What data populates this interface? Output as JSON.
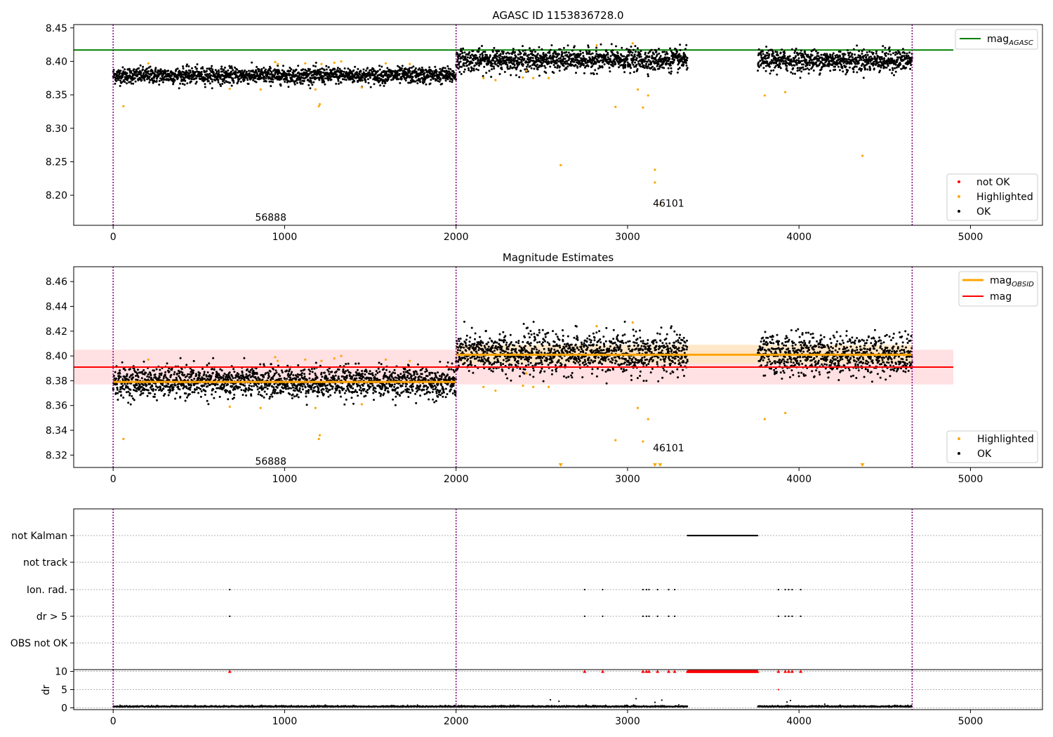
{
  "colors": {
    "ok": "#000000",
    "highlighted": "#ffa500",
    "not_ok": "#ff0000",
    "agasc_line": "#008000",
    "obsid_line": "#ffa500",
    "mag_line": "#ff0000",
    "obs_boundary": "#800080",
    "mag_band": "#ffdde0",
    "obsid_band": "#ffe6c2"
  },
  "chart_data": [
    {
      "type": "scatter",
      "title": "AGASC ID 1153836728.0",
      "xlim": [
        -230,
        5420
      ],
      "ylim": [
        8.155,
        8.455
      ],
      "xticks": [
        0,
        1000,
        2000,
        3000,
        4000,
        5000
      ],
      "yticks": [
        8.2,
        8.25,
        8.3,
        8.35,
        8.4,
        8.45
      ],
      "obsid_boundaries": [
        0,
        2000,
        4660
      ],
      "obsid_annotations": [
        {
          "x": 910,
          "y": 8.167,
          "label": "56888"
        },
        {
          "x": 3230,
          "y": 8.188,
          "label": "46101"
        }
      ],
      "reference_lines": [
        {
          "name": "mag",
          "subscript": "AGASC",
          "y": 8.417,
          "x_range": [
            -230,
            4900
          ],
          "color": "#008000"
        }
      ],
      "series": [
        {
          "name": "not OK",
          "color": "#ff0000"
        },
        {
          "name": "Highlighted",
          "color": "#ffa500"
        },
        {
          "name": "OK",
          "color": "#000000"
        }
      ],
      "ok_segments": [
        {
          "x_range": [
            0,
            2000
          ],
          "mean": 8.379,
          "spread": 0.006
        },
        {
          "x_range": [
            2000,
            3350
          ],
          "mean": 8.402,
          "spread": 0.008
        },
        {
          "x_range": [
            3760,
            4660
          ],
          "mean": 8.401,
          "spread": 0.008
        }
      ],
      "highlighted_points": [
        [
          60,
          8.333
        ],
        [
          205,
          8.397
        ],
        [
          680,
          8.359
        ],
        [
          860,
          8.358
        ],
        [
          945,
          8.399
        ],
        [
          960,
          8.396
        ],
        [
          1120,
          8.397
        ],
        [
          1180,
          8.358
        ],
        [
          1200,
          8.333
        ],
        [
          1205,
          8.336
        ],
        [
          1215,
          8.396
        ],
        [
          1290,
          8.398
        ],
        [
          1330,
          8.4
        ],
        [
          1450,
          8.361
        ],
        [
          1590,
          8.397
        ],
        [
          1730,
          8.396
        ],
        [
          2160,
          8.375
        ],
        [
          2230,
          8.372
        ],
        [
          2390,
          8.376
        ],
        [
          2410,
          8.386
        ],
        [
          2450,
          8.375
        ],
        [
          2540,
          8.375
        ],
        [
          2610,
          8.245
        ],
        [
          2820,
          8.424
        ],
        [
          2930,
          8.332
        ],
        [
          3030,
          8.427
        ],
        [
          3060,
          8.358
        ],
        [
          3090,
          8.331
        ],
        [
          3120,
          8.349
        ],
        [
          3160,
          8.238
        ],
        [
          3160,
          8.219
        ],
        [
          3190,
          8.186
        ],
        [
          3800,
          8.349
        ],
        [
          3920,
          8.354
        ],
        [
          4370,
          8.259
        ]
      ],
      "legend": [
        {
          "label": "mag",
          "subscript": "AGASC",
          "position": "top-right"
        },
        {
          "labels": [
            "not OK",
            "Highlighted",
            "OK"
          ],
          "position": "bottom-right"
        }
      ]
    },
    {
      "type": "scatter",
      "title": "Magnitude Estimates",
      "xlim": [
        -230,
        5420
      ],
      "ylim": [
        8.31,
        8.472
      ],
      "xticks": [
        0,
        1000,
        2000,
        3000,
        4000,
        5000
      ],
      "yticks": [
        8.32,
        8.34,
        8.36,
        8.38,
        8.4,
        8.42,
        8.44,
        8.46
      ],
      "obsid_boundaries": [
        0,
        2000,
        4660
      ],
      "obsid_annotations": [
        {
          "x": 910,
          "y": 8.315,
          "label": "56888"
        },
        {
          "x": 3230,
          "y": 8.326,
          "label": "46101"
        }
      ],
      "bands": [
        {
          "x_range": [
            -230,
            4900
          ],
          "y_range": [
            8.377,
            8.405
          ],
          "color": "#ffdde0"
        },
        {
          "x_range": [
            2000,
            3350
          ],
          "y_range": [
            8.394,
            8.409
          ],
          "color": "#ffe6c2"
        },
        {
          "x_range": [
            3350,
            4660
          ],
          "y_range": [
            8.394,
            8.409
          ],
          "color": "#ffe6c2"
        }
      ],
      "reference_lines": [
        {
          "name": "mag",
          "subscript": "OBSID",
          "segments": [
            {
              "x_range": [
                0,
                2000
              ],
              "y": 8.379
            },
            {
              "x_range": [
                2000,
                4660
              ],
              "y": 8.401
            }
          ],
          "color": "#ffa500"
        },
        {
          "name": "mag",
          "y": 8.391,
          "x_range": [
            -230,
            4900
          ],
          "color": "#ff0000"
        }
      ],
      "series": [
        {
          "name": "Highlighted",
          "color": "#ffa500"
        },
        {
          "name": "OK",
          "color": "#000000"
        }
      ],
      "offscale_markers_x": [
        2610,
        3160,
        3190,
        4370
      ],
      "legend": [
        {
          "labels": [
            "mag (OBSID)",
            "mag"
          ],
          "position": "top-right"
        },
        {
          "labels": [
            "Highlighted",
            "OK"
          ],
          "position": "bottom-right"
        }
      ]
    },
    {
      "type": "scatter",
      "title": "",
      "xlim": [
        -230,
        5420
      ],
      "xticks": [
        0,
        1000,
        2000,
        3000,
        4000,
        5000
      ],
      "flag_rows": [
        "not Kalman",
        "not track",
        "Ion. rad.",
        "dr > 5",
        "OBS not OK"
      ],
      "obsid_boundaries": [
        0,
        2000,
        4660
      ],
      "flags": {
        "not Kalman": {
          "x_range": [
            3350,
            3760
          ]
        },
        "not track": {
          "x_points": []
        },
        "Ion. rad.": {
          "x_points": [
            680,
            2750,
            2855,
            3090,
            3110,
            3125,
            3175,
            3240,
            3275,
            3880,
            3920,
            3940,
            3960,
            4010
          ]
        },
        "dr > 5": {
          "x_points": [
            680,
            2750,
            2855,
            3090,
            3110,
            3125,
            3175,
            3240,
            3275,
            3880,
            3920,
            3940,
            3960,
            4010
          ]
        },
        "OBS not OK": {
          "x_points": []
        }
      }
    },
    {
      "type": "scatter",
      "title": "",
      "ylabel": "dr",
      "xlim": [
        -230,
        5420
      ],
      "ylim": [
        -0.5,
        10.5
      ],
      "xticks": [
        0,
        1000,
        2000,
        3000,
        4000,
        5000
      ],
      "yticks": [
        0,
        5,
        10
      ],
      "obsid_boundaries": [
        0,
        2000,
        4660
      ],
      "dr_baseline": 0.25,
      "clipped_markers_x": [
        680,
        2750,
        2855,
        3090,
        3110,
        3125,
        3175,
        3240,
        3275,
        3880,
        3920,
        3940,
        3960,
        4010
      ],
      "clipped_range": [
        3350,
        3760
      ],
      "outliers": [
        [
          2550,
          2.2
        ],
        [
          2600,
          1.8
        ],
        [
          3050,
          2.5
        ],
        [
          3160,
          1.5
        ],
        [
          3200,
          2.1
        ],
        [
          3880,
          5.0
        ],
        [
          3930,
          1.6
        ],
        [
          3950,
          2.0
        ],
        [
          4150,
          1.0
        ]
      ]
    }
  ]
}
